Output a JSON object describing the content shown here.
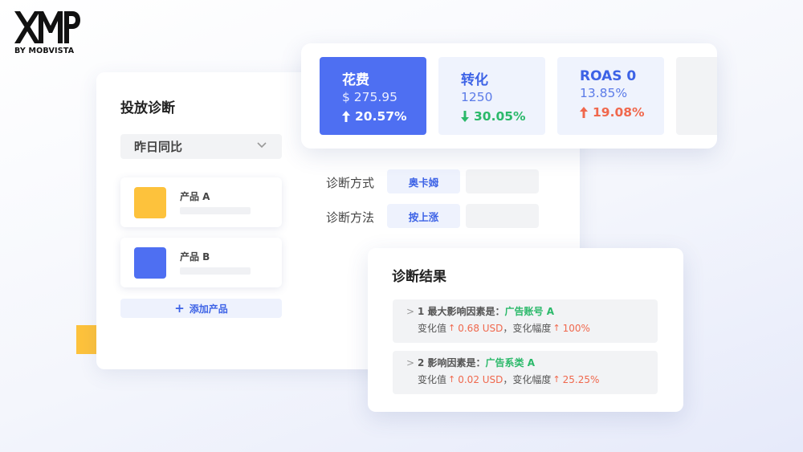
{
  "logo": {
    "brand": "XMP",
    "subtitle": "BY MOBVISTA"
  },
  "diagnosis_panel": {
    "title": "投放诊断",
    "dropdown_value": "昨日同比",
    "products": [
      {
        "name": "产品 A",
        "color": "#fdc23c"
      },
      {
        "name": "产品 B",
        "color": "#4e6ff2"
      }
    ],
    "add_product_label": "添加产品",
    "rows": [
      {
        "label": "诊断方式",
        "value": "奥卡姆"
      },
      {
        "label": "诊断方法",
        "value": "按上涨"
      }
    ]
  },
  "metrics": [
    {
      "title": "花费",
      "value": "$ 275.95",
      "change": "20.57%",
      "direction": "up",
      "color": "#ffffff"
    },
    {
      "title": "转化",
      "value": "1250",
      "change": "30.05%",
      "direction": "down",
      "color": "#2bb96a"
    },
    {
      "title": "ROAS 0",
      "value": "13.85%",
      "change": "19.08%",
      "direction": "up",
      "color": "#f0684d"
    }
  ],
  "result_panel": {
    "title": "诊断结果",
    "items": [
      {
        "prefix": "1 最大影响因素是：",
        "factor": "广告账号 A",
        "change_label": "变化值",
        "change_value": "0.68 USD",
        "separator": "，变化幅度",
        "change_pct": "100%"
      },
      {
        "prefix": "2 影响因素是：",
        "factor": "广告系类 A",
        "change_label": "变化值",
        "change_value": "0.02 USD",
        "separator": "，变化幅度",
        "change_pct": "25.25%"
      }
    ]
  },
  "colors": {
    "accent_blue": "#4e6ff2",
    "accent_yellow": "#fdc23c",
    "up_red": "#f0684d",
    "down_green": "#2bb96a"
  }
}
